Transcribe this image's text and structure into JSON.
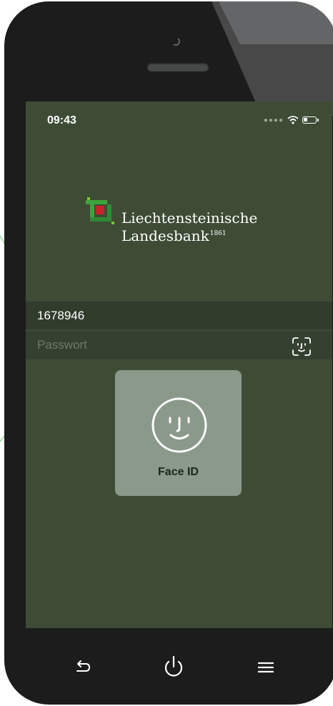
{
  "status_bar": {
    "time": "09:43",
    "signal_icon": "signal-dots-icon",
    "wifi_icon": "wifi-icon",
    "battery_icon": "battery-icon"
  },
  "logo": {
    "line1": "Liechtensteinische",
    "line2": "Landesbank",
    "year": "1861"
  },
  "login": {
    "username": "1678946",
    "password_placeholder": "Passwort",
    "faceid_icon": "face-id-icon"
  },
  "faceid_dialog": {
    "label": "Face ID",
    "icon": "face-icon"
  },
  "nav": {
    "back_icon": "back-arrow-icon",
    "power_icon": "power-icon",
    "menu_icon": "menu-icon"
  },
  "colors": {
    "screen_bg": "#3e4c36",
    "dialog_bg": "#8a998a",
    "logo_red": "#c8232c",
    "logo_green": "#3ea33c"
  }
}
